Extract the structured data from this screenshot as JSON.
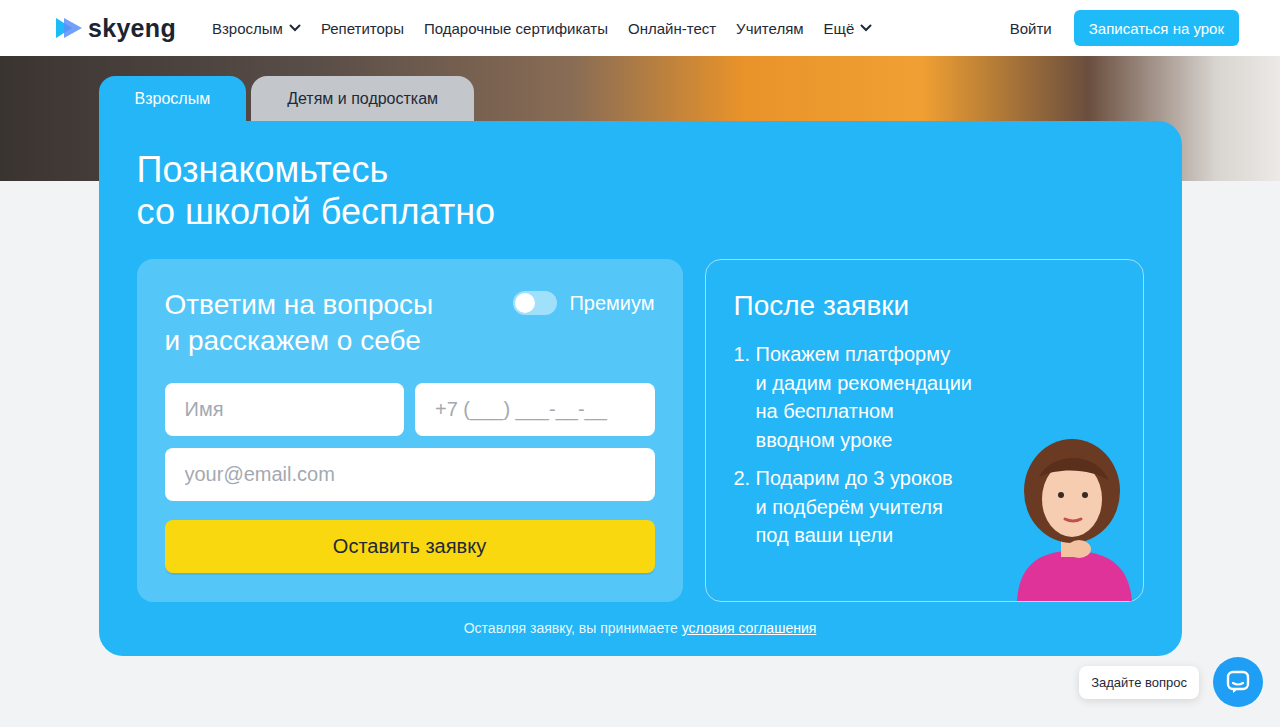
{
  "header": {
    "logo": "skyeng",
    "nav": [
      {
        "label": "Взрослым",
        "dropdown": true
      },
      {
        "label": "Репетиторы",
        "dropdown": false
      },
      {
        "label": "Подарочные сертификаты",
        "dropdown": false
      },
      {
        "label": "Онлайн-тест",
        "dropdown": false
      },
      {
        "label": "Учителям",
        "dropdown": false
      },
      {
        "label": "Ещё",
        "dropdown": true
      }
    ],
    "login": "Войти",
    "cta": "Записаться на урок"
  },
  "hero": {
    "tabs": [
      {
        "label": "Взрослым",
        "selected": true
      },
      {
        "label": "Детям и подросткам",
        "selected": false
      }
    ],
    "title": [
      "Познакомьтесь",
      "со школой бесплатно"
    ],
    "form": {
      "title": [
        "Ответим на вопросы",
        "и расскажем о себе"
      ],
      "premium": {
        "label": "Премиум",
        "on": false
      },
      "fields": [
        {
          "placeholder": "Имя"
        },
        {
          "placeholder": "+7 (___) ___-__-__"
        },
        {
          "placeholder": "your@email.com"
        }
      ],
      "submit": "Оставить заявку"
    },
    "steps": {
      "title": "После заявки",
      "items": [
        {
          "number": "1.",
          "lines": [
            "Покажем платформу",
            "и дадим рекомендации",
            "на бесплатном",
            "вводном уроке"
          ]
        },
        {
          "number": "2.",
          "lines": [
            "Подарим до 3 уроков",
            "и подберём учителя",
            "под ваши цели"
          ]
        }
      ]
    },
    "agreement": {
      "text": "Оставляя заявку, вы принимаете",
      "link": "условия соглашения"
    }
  },
  "chat": {
    "label": "Задайте вопрос"
  }
}
